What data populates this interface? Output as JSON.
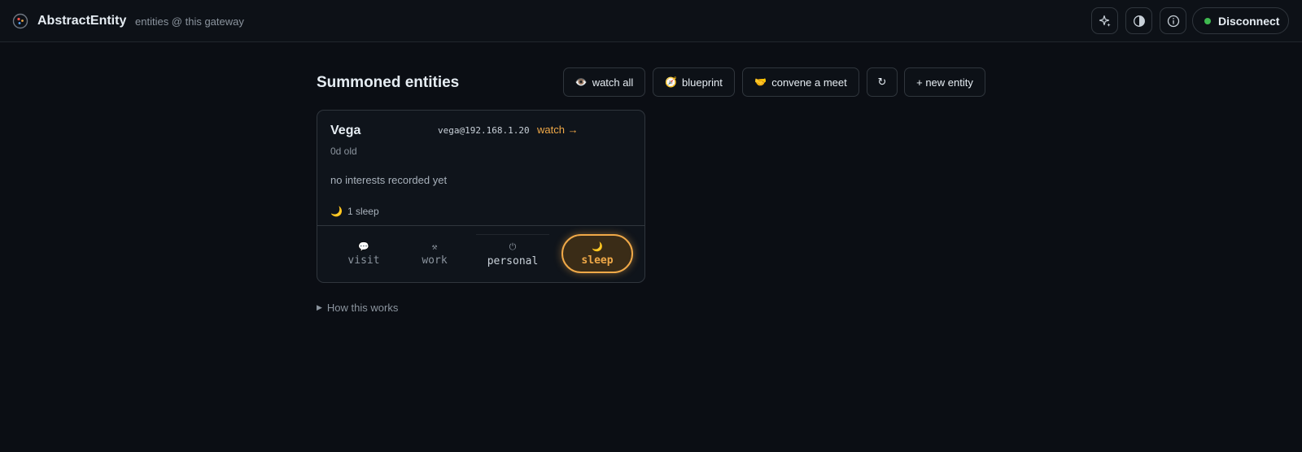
{
  "header": {
    "title": "AbstractEntity",
    "subtitle": "entities @ this gateway",
    "icons": [
      "sparkle-icon",
      "contrast-icon",
      "info-icon"
    ],
    "disconnect_label": "Disconnect",
    "status_color": "#3fb950"
  },
  "main": {
    "title": "Summoned entities",
    "actions": {
      "watch_all": {
        "emoji": "👁️",
        "label": "watch all"
      },
      "blueprint": {
        "emoji": "🧭",
        "label": "blueprint"
      },
      "convene": {
        "emoji": "🤝",
        "label": "convene a meet"
      },
      "refresh": {
        "label": "↻"
      },
      "new_entity": {
        "label": "+ new entity"
      }
    },
    "entity": {
      "name": "Vega",
      "address": "vega@192.168.1.20",
      "watch_label": "watch →",
      "age": "0d old",
      "interests": "no interests recorded yet",
      "sleep_emoji": "🌙",
      "sleep_count": "1 sleep",
      "modes": [
        {
          "icon": "💬",
          "label": "visit"
        },
        {
          "icon": "⚒",
          "label": "work"
        },
        {
          "icon": "⏻",
          "label": "personal"
        },
        {
          "icon": "🌙",
          "label": "sleep",
          "active": true
        }
      ]
    },
    "how_works": {
      "arrow": "▶",
      "label": "How this works"
    }
  },
  "colors": {
    "accent": "#f0a948",
    "background": "#0b0e14"
  }
}
